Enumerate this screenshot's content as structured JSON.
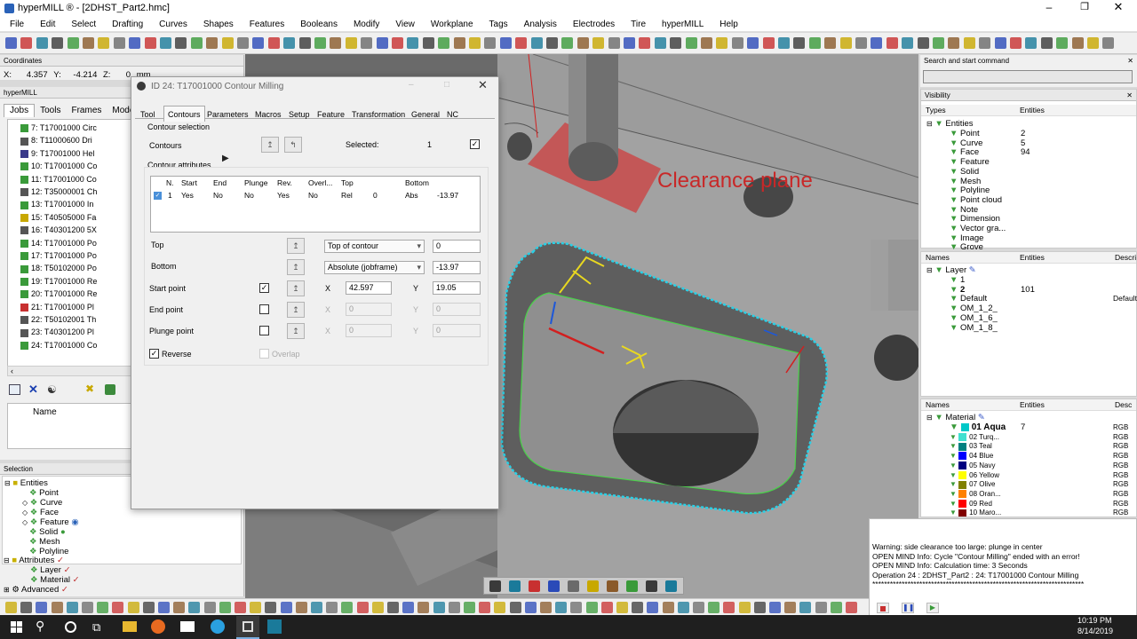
{
  "window": {
    "title": "hyperMILL ® - [2DHST_Part2.hmc]"
  },
  "menu": [
    "File",
    "Edit",
    "Select",
    "Drafting",
    "Curves",
    "Shapes",
    "Features",
    "Booleans",
    "Modify",
    "View",
    "Workplane",
    "Tags",
    "Analysis",
    "Electrodes",
    "Tire",
    "hyperMILL",
    "Help"
  ],
  "coordinates": {
    "title": "Coordinates",
    "x_label": "X:",
    "x": "4.357",
    "y_label": "Y:",
    "y": "-4.214",
    "z_label": "Z:",
    "z": "0",
    "units": "mm"
  },
  "hypermill_panel": {
    "title": "hyperMILL",
    "tabs": [
      "Jobs",
      "Tools",
      "Frames",
      "Models"
    ],
    "jobs": [
      "7: T17001000 Circ",
      "8: T11000600 Dri",
      "9: T17001000 Hel",
      "10: T17001000 Co",
      "11: T17001000 Co",
      "12: T35000001 Ch",
      "13: T17001000 In",
      "15: T40505000 Fa",
      "16: T40301200 5X",
      "14: T17001000 Po",
      "17: T17001000 Po",
      "18: T50102000 Po",
      "19: T17001000 Re",
      "20: T17001000 Re",
      "21: T17001000 Pl",
      "22: T50102001 Th",
      "23: T40301200 Pl",
      "24: T17001000 Co"
    ],
    "bottom_column": "Name"
  },
  "selection_panel": {
    "title": "Selection",
    "entities_label": "Entities",
    "entities": [
      "Point",
      "Curve",
      "Face",
      "Feature",
      "Solid",
      "Mesh",
      "Polyline"
    ],
    "attributes_label": "Attributes",
    "attributes": [
      "Layer",
      "Material"
    ],
    "advanced": "Advanced"
  },
  "viewport": {
    "annotation": "Clearance plane"
  },
  "dialog": {
    "title": "ID 24: T17001000 Contour Milling",
    "tabs": [
      "Tool",
      "Contours",
      "Parameters",
      "Macros",
      "Setup",
      "Feature",
      "Transformation",
      "General",
      "NC"
    ],
    "active_tab": "Contours",
    "contour_selection_label": "Contour selection",
    "contours_label": "Contours",
    "selected_label": "Selected:",
    "selected_count": "1",
    "contour_attributes_label": "Contour attributes",
    "table": {
      "headers": [
        "N.",
        "Start",
        "End",
        "Plunge",
        "Rev.",
        "Overl...",
        "Top",
        "",
        "Bottom",
        ""
      ],
      "rows": [
        [
          "1",
          "Yes",
          "No",
          "No",
          "Yes",
          "No",
          "Rel",
          "0",
          "Abs",
          "-13.97"
        ]
      ]
    },
    "top_label": "Top",
    "top_mode": "Top of contour",
    "top_value": "0",
    "bottom_label": "Bottom",
    "bottom_mode": "Absolute (jobframe)",
    "bottom_value": "-13.97",
    "start_point_label": "Start point",
    "start_x": "42.597",
    "start_y": "19.05",
    "end_point_label": "End point",
    "end_x": "0",
    "end_y": "0",
    "plunge_point_label": "Plunge point",
    "plunge_x": "0",
    "plunge_y": "0",
    "x_label": "X",
    "y_label": "Y",
    "reverse_label": "Reverse",
    "overlap_label": "Overlap"
  },
  "search": {
    "title": "Search and start command",
    "value": ""
  },
  "visibility": {
    "title": "Visibility",
    "col_types": "Types",
    "col_entities": "Entities",
    "root": "Entities",
    "items": [
      {
        "name": "Point",
        "count": "2"
      },
      {
        "name": "Curve",
        "count": "5"
      },
      {
        "name": "Face",
        "count": "94"
      },
      {
        "name": "Feature",
        "count": ""
      },
      {
        "name": "Solid",
        "count": ""
      },
      {
        "name": "Mesh",
        "count": ""
      },
      {
        "name": "Polyline",
        "count": ""
      },
      {
        "name": "Point cloud",
        "count": ""
      },
      {
        "name": "Note",
        "count": ""
      },
      {
        "name": "Dimension",
        "count": ""
      },
      {
        "name": "Vector gra...",
        "count": ""
      },
      {
        "name": "Image",
        "count": ""
      },
      {
        "name": "Grove",
        "count": ""
      }
    ]
  },
  "layers": {
    "col_names": "Names",
    "col_entities": "Entities",
    "col_desc": "Descri",
    "root": "Layer",
    "items": [
      {
        "name": "1",
        "count": "",
        "desc": ""
      },
      {
        "name": "2",
        "count": "101",
        "desc": ""
      },
      {
        "name": "Default",
        "count": "",
        "desc": "Default"
      },
      {
        "name": "OM_1_2_",
        "count": "",
        "desc": ""
      },
      {
        "name": "OM_1_6_",
        "count": "",
        "desc": ""
      },
      {
        "name": "OM_1_8_",
        "count": "",
        "desc": ""
      }
    ]
  },
  "materials": {
    "col_names": "Names",
    "col_entities": "Entities",
    "col_desc": "Desc",
    "root": "Material",
    "items": [
      {
        "name": "01 Aqua",
        "count": "7",
        "desc": "RGB",
        "color": "#00c8c8"
      },
      {
        "name": "02 Turq...",
        "count": "",
        "desc": "RGB",
        "color": "#40e0d0"
      },
      {
        "name": "03 Teal",
        "count": "",
        "desc": "RGB",
        "color": "#008080"
      },
      {
        "name": "04 Blue",
        "count": "",
        "desc": "RGB",
        "color": "#0000ff"
      },
      {
        "name": "05 Navy",
        "count": "",
        "desc": "RGB",
        "color": "#000080"
      },
      {
        "name": "06 Yellow",
        "count": "",
        "desc": "RGB",
        "color": "#ffff00"
      },
      {
        "name": "07 Olive",
        "count": "",
        "desc": "RGB",
        "color": "#808000"
      },
      {
        "name": "08 Oran...",
        "count": "",
        "desc": "RGB",
        "color": "#ff8000"
      },
      {
        "name": "09 Red",
        "count": "",
        "desc": "RGB",
        "color": "#ff0000"
      },
      {
        "name": "10 Maro...",
        "count": "",
        "desc": "RGB",
        "color": "#800000"
      }
    ]
  },
  "messages": [
    "Warning: side clearance too large: plunge in center",
    "OPEN MIND Info:    Cycle \"Contour Milling\" ended with an error!",
    "OPEN MIND Info:    Calculation time: 3 Seconds",
    "Operation 24 : 2DHST_Part2 :  24: T17001000 Contour Milling",
    "************************************************************************"
  ],
  "clock": {
    "time": "10:19 PM",
    "date": "8/14/2019"
  }
}
